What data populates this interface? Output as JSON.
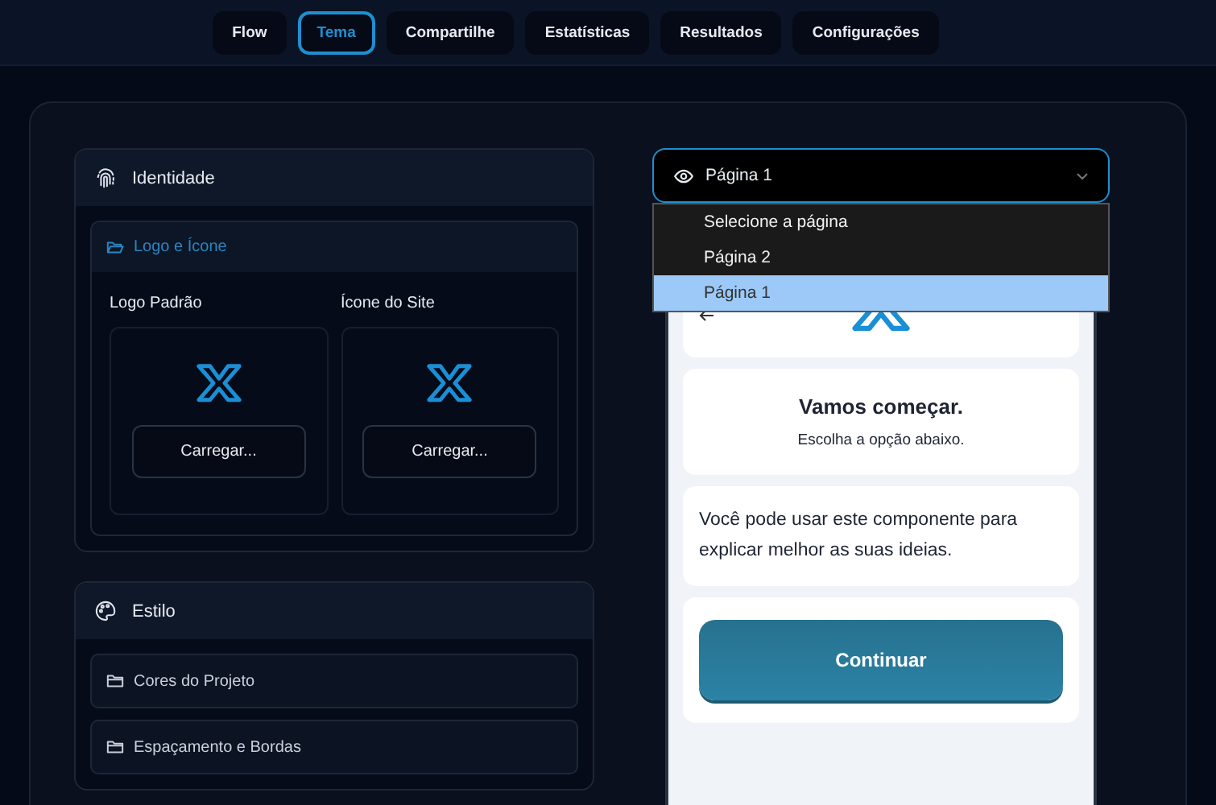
{
  "tabs": [
    {
      "label": "Flow",
      "selected": false
    },
    {
      "label": "Tema",
      "selected": true
    },
    {
      "label": "Compartilhe",
      "selected": false
    },
    {
      "label": "Estatísticas",
      "selected": false
    },
    {
      "label": "Resultados",
      "selected": false
    },
    {
      "label": "Configurações",
      "selected": false
    }
  ],
  "identity": {
    "title": "Identidade",
    "section": "Logo e Ícone",
    "slots": [
      {
        "label": "Logo Padrão",
        "button": "Carregar..."
      },
      {
        "label": "Ícone do Site",
        "button": "Carregar..."
      }
    ]
  },
  "style": {
    "title": "Estilo",
    "items": [
      "Cores do Projeto",
      "Espaçamento e Bordas"
    ]
  },
  "page_select": {
    "value": "Página 1",
    "expanded": true,
    "options": [
      {
        "label": "Selecione a página",
        "selected": false
      },
      {
        "label": "Página 2",
        "selected": false
      },
      {
        "label": "Página 1",
        "selected": true
      }
    ]
  },
  "preview": {
    "heading": "Vamos começar.",
    "subheading": "Escolha a opção abaixo.",
    "text": "Você pode usar este componente para explicar melhor as suas ideias.",
    "button": "Continuar"
  }
}
